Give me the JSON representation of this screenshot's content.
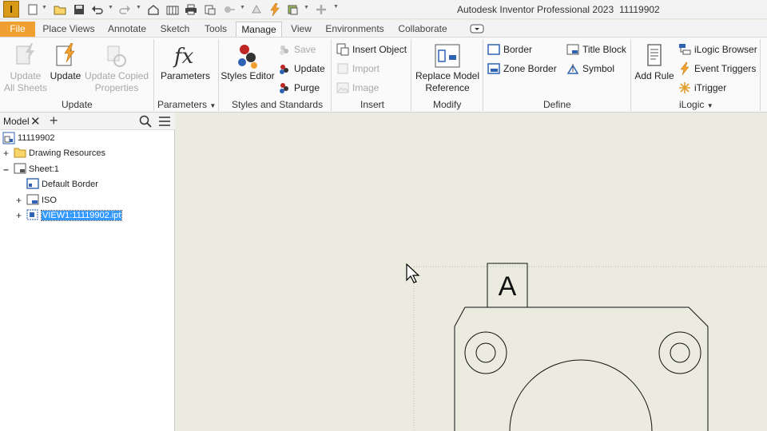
{
  "app": {
    "logo": "I",
    "title": "Autodesk Inventor Professional 2023",
    "file_name": "11119902"
  },
  "quick_access": [
    "new-icon",
    "open-icon",
    "save-icon",
    "undo-icon",
    "redo-icon",
    "home-icon",
    "sketch-icon",
    "print-icon",
    "local-update-icon",
    "selection-icon",
    "rebuild-icon",
    "update-icon",
    "appearance-icon",
    "add-icon",
    "customize-icon"
  ],
  "tabs": [
    "File",
    "Place Views",
    "Annotate",
    "Sketch",
    "Tools",
    "Manage",
    "View",
    "Environments",
    "Collaborate"
  ],
  "active_tab": "Manage",
  "ribbon": {
    "update": {
      "label": "Update",
      "update_all_1": "Update",
      "update_all_2": "All Sheets",
      "update": "Update",
      "copied_1": "Update Copied",
      "copied_2": "Properties"
    },
    "parameters": {
      "label": "Parameters",
      "button": "Parameters"
    },
    "styles": {
      "label": "Styles and Standards",
      "editor_1": "Styles Editor",
      "save": "Save",
      "update": "Update",
      "purge": "Purge"
    },
    "insert": {
      "label": "Insert",
      "object": "Insert Object",
      "import": "Import",
      "image": "Image"
    },
    "modify": {
      "label": "Modify",
      "replace_1": "Replace Model",
      "replace_2": "Reference"
    },
    "define": {
      "label": "Define",
      "border": "Border",
      "zone_border": "Zone Border",
      "title_block": "Title Block",
      "symbol": "Symbol"
    },
    "ilogic": {
      "label": "iLogic",
      "add_rule": "Add Rule",
      "browser": "iLogic Browser",
      "triggers": "Event Triggers",
      "itrigger": "iTrigger"
    }
  },
  "browser": {
    "tab": "Model",
    "items": [
      {
        "label": "11119902"
      },
      {
        "label": "Drawing Resources"
      },
      {
        "label": "Sheet:1"
      },
      {
        "label": "Default Border"
      },
      {
        "label": "ISO"
      },
      {
        "label": "VIEW1:11119902.ipt"
      }
    ]
  },
  "canvas": {
    "datum_label": "A"
  },
  "colors": {
    "file_tab": "#f0a030",
    "canvas_bg": "#ecebdf",
    "selection": "#3399ff"
  }
}
